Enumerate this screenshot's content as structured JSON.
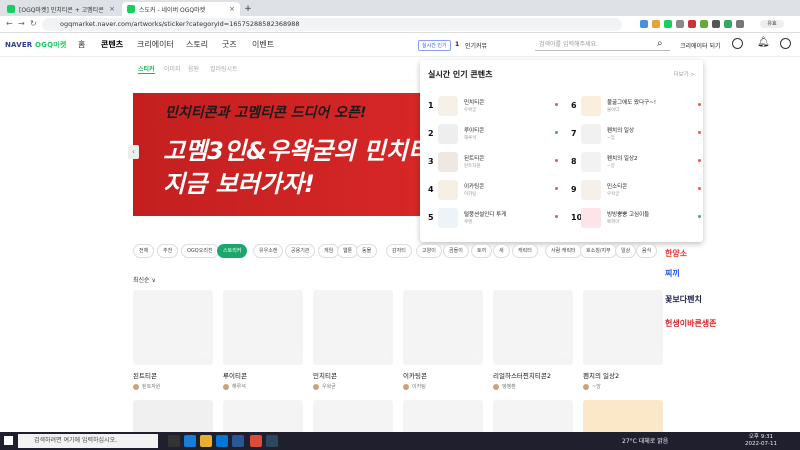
{
  "browser": {
    "tabs": [
      {
        "title": "[OGQ마켓] 민치티콘 + 고멤티콘"
      },
      {
        "title": "스도커 - 네이버 OGQ마켓"
      }
    ],
    "url": "ogqmarket.naver.com/artworks/sticker?categoryId=16575288582368988",
    "profile": "유효"
  },
  "header": {
    "logo_naver": "NAVER",
    "logo_ogq": "OGQ마켓",
    "nav": [
      "홈",
      "콘텐츠",
      "크리에이터",
      "스토리",
      "굿즈",
      "이벤트"
    ],
    "live_badge": "실시간 인기",
    "live_rank": "1",
    "live_item": "인기커뮤",
    "search_placeholder": "검색어를 입력해주세요.",
    "creator_btn": "크리에이터 되기"
  },
  "subnav": [
    "스티커",
    "이미지",
    "음원",
    "컬러링시트"
  ],
  "banner": {
    "line1": "민치티콘과 고멤티콘 드디어 오픈!",
    "line2": "고멤3인&우왁굳의 민치티",
    "line3": "지금 보러가자!"
  },
  "popup": {
    "title": "실시간 인기 콘텐츠",
    "more": "더보기 >",
    "ranks": [
      {
        "num": "1",
        "name": "민치티콘",
        "author": "우왁굳"
      },
      {
        "num": "2",
        "name": "루이티콘",
        "author": "해루석"
      },
      {
        "num": "3",
        "name": "된트티콘",
        "author": "된트자원"
      },
      {
        "num": "4",
        "name": "이카팅콘",
        "author": "이카팅"
      },
      {
        "num": "5",
        "name": "털뭉션설인디 투게",
        "author": "쿠앤"
      },
      {
        "num": "6",
        "name": "불굴그에도 왔다구~!",
        "author": "불이다"
      },
      {
        "num": "7",
        "name": "펜치의 일상",
        "author": "~앙"
      },
      {
        "num": "8",
        "name": "펜치의 일상2",
        "author": "~앙"
      },
      {
        "num": "9",
        "name": "민소티콘",
        "author": "우왁굳"
      },
      {
        "num": "10",
        "name": "빙빙뿡뿡 고심이들",
        "author": "뽀피아"
      }
    ]
  },
  "chips": [
    "전체",
    "추천",
    "OGQ오리진",
    "스토리커",
    "유우소캔",
    "공용기관",
    "게임",
    "웹툰",
    "동물",
    "감자티",
    "고양이",
    "곰돌이",
    "토끼",
    "새",
    "캐릭터",
    "사람 캐릭터",
    "호소칭/지부",
    "일상",
    "음식"
  ],
  "sort_label": "최신순 ∨",
  "cards": [
    {
      "title": "된트티콘",
      "author": "된트자원"
    },
    {
      "title": "루이티콘",
      "author": "해루석"
    },
    {
      "title": "민치티콘",
      "author": "우왁굳"
    },
    {
      "title": "이카팅콘",
      "author": "이카팅"
    },
    {
      "title": "리얼하스터찐치티콘2",
      "author": "엥엥환"
    },
    {
      "title": "펜치의 일상2",
      "author": "~앙"
    }
  ],
  "side_floats": [
    {
      "text": "한양소",
      "color": "#e33"
    },
    {
      "text": "찌끼",
      "color": "#25f"
    },
    {
      "text": "꽃보다펜치",
      "color": "#225"
    },
    {
      "text": "헌생이바른생존",
      "color": "#d22"
    }
  ],
  "taskbar": {
    "search": "검색하려면 여기에 입력하십시오.",
    "weather": "27°C 대체로 맑음",
    "time": "오후 9:31",
    "date": "2022-07-11"
  },
  "colors": {
    "accent": "#19a86b",
    "banner": "#d72727",
    "naver_blue": "#2c3a97"
  }
}
